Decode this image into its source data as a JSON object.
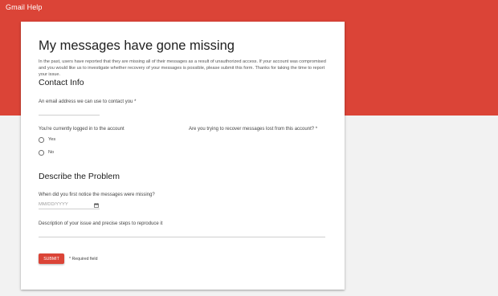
{
  "header": {
    "app_title": "Gmail Help"
  },
  "form": {
    "title": "My messages have gone missing",
    "intro": "In the past, users have reported that they are missing all of their messages as a result of unauthorized access. If your account was compromised and you would like us to investigate whether recovery of your messages is possible, please submit this form. Thanks for taking the time to report your issue.",
    "contact_section": {
      "heading": "Contact Info",
      "email_label": "An email address we can use to contact you *",
      "email_value": "",
      "logged_in_label": "You're currently logged in to the account",
      "recover_question": "Are you trying to recover messages lost from this account? *",
      "options": [
        {
          "label": "Yes"
        },
        {
          "label": "No"
        }
      ]
    },
    "problem_section": {
      "heading": "Describe the Problem",
      "date_label": "When did you first notice the messages were missing?",
      "date_placeholder": "MM/DD/YYYY",
      "description_label": "Description of your issue and precise steps to reproduce it",
      "description_value": ""
    },
    "submit_label": "SUBMIT",
    "required_note": "* Required field"
  },
  "colors": {
    "accent": "#db4437",
    "background": "#f2f2f2"
  },
  "icons": {
    "date_picker": "calendar-icon"
  }
}
